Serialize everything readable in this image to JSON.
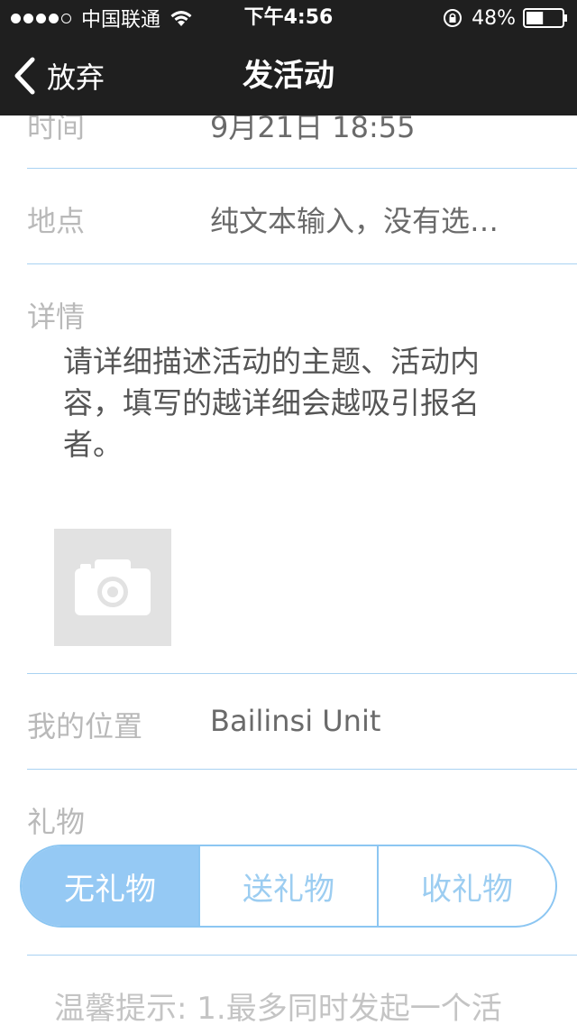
{
  "status_bar": {
    "carrier": "中国联通",
    "time": "下午4:56",
    "battery": "48%",
    "battery_level": 0.48,
    "signal_bars": 4,
    "icons": [
      "wifi-icon",
      "rotation-lock-icon",
      "battery-icon"
    ]
  },
  "nav": {
    "back_label": "放弃",
    "title": "发活动"
  },
  "form": {
    "time_label": "时间",
    "time_value": "9月21日 18:55",
    "location_label": "地点",
    "location_value": "纯文本输入，没有选…",
    "details_label": "详情",
    "details_placeholder": "请详细描述活动的主题、活动内容，填写的越详细会越吸引报名者。",
    "my_location_label": "我的位置",
    "my_location_value": "Bailinsi Unit",
    "gift_label": "礼物",
    "gift_options": [
      "无礼物",
      "送礼物",
      "收礼物"
    ],
    "gift_selected": "无礼物",
    "tip": "温馨提示: 1.最多同时发起一个活"
  },
  "colors": {
    "bar_bg": "#1f1f1f",
    "divider": "#a9d2f2",
    "accent": "#95c9f4",
    "label": "#b9b9b9",
    "value": "#6a6a6a"
  }
}
